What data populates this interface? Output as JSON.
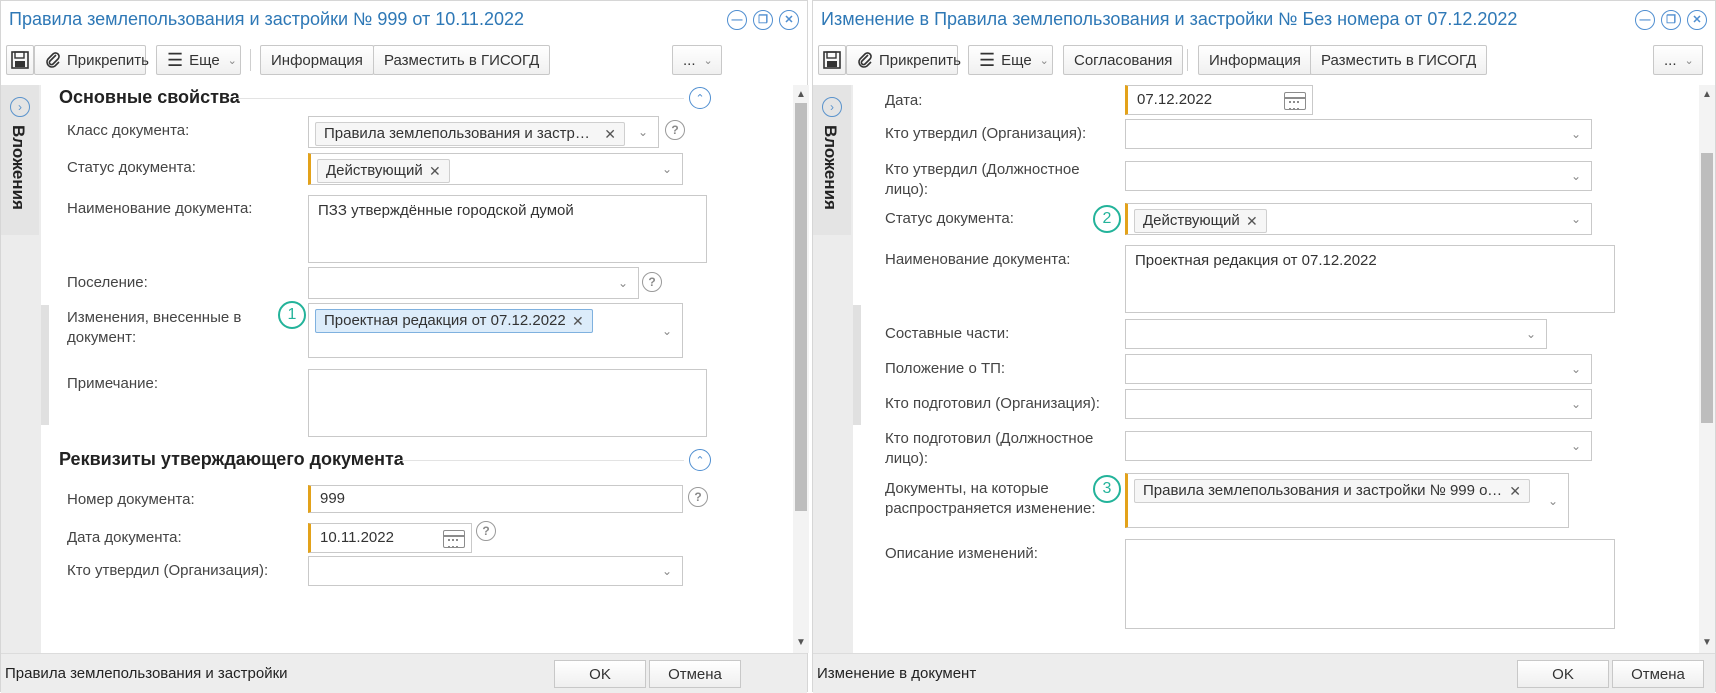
{
  "left": {
    "title": "Правила землепользования и застройки № 999 от 10.11.2022",
    "toolbar": {
      "attach": "Прикрепить",
      "more": "Еще",
      "info": "Информация",
      "place": "Разместить в ГИСОГД",
      "dots": "..."
    },
    "side_tab": "Вложения",
    "sections": {
      "main": "Основные свойства",
      "requisites": "Реквизиты утверждающего документа"
    },
    "fields": {
      "doc_class": {
        "label": "Класс документа:",
        "value": "Правила землепользования и застро…"
      },
      "status": {
        "label": "Статус документа:",
        "value": "Действующий"
      },
      "name": {
        "label": "Наименование документа:",
        "value": "ПЗЗ утверждённые городской думой"
      },
      "settlement": {
        "label": "Поселение:",
        "value": ""
      },
      "changes": {
        "label": "Изменения, внесенные в документ:",
        "value": "Проектная редакция от 07.12.2022",
        "marker": "1"
      },
      "note": {
        "label": "Примечание:",
        "value": ""
      },
      "doc_number": {
        "label": "Номер документа:",
        "value": "999"
      },
      "doc_date": {
        "label": "Дата документа:",
        "value": "10.11.2022"
      },
      "approved_org": {
        "label": "Кто утвердил (Организация):",
        "value": ""
      }
    },
    "footer": {
      "text": "Правила землепользования и застройки",
      "ok": "OK",
      "cancel": "Отмена"
    }
  },
  "right": {
    "title": "Изменение в Правила землепользования и застройки № Без номера от 07.12.2022",
    "toolbar": {
      "attach": "Прикрепить",
      "more": "Еще",
      "approvals": "Согласования",
      "info": "Информация",
      "place": "Разместить в ГИСОГД",
      "dots": "..."
    },
    "side_tab": "Вложения",
    "fields": {
      "date": {
        "label": "Дата:",
        "value": "07.12.2022"
      },
      "approved_org": {
        "label": "Кто утвердил (Организация):",
        "value": ""
      },
      "approved_person": {
        "label": "Кто утвердил (Должностное лицо):",
        "value": ""
      },
      "status": {
        "label": "Статус документа:",
        "value": "Действующий",
        "marker": "2"
      },
      "name": {
        "label": "Наименование документа:",
        "value": "Проектная редакция от 07.12.2022"
      },
      "parts": {
        "label": "Составные части:",
        "value": ""
      },
      "tp_position": {
        "label": "Положение о ТП:",
        "value": ""
      },
      "prepared_org": {
        "label": "Кто подготовил (Организация):",
        "value": ""
      },
      "prepared_person": {
        "label": "Кто подготовил (Должностное лицо):",
        "value": ""
      },
      "applies_to": {
        "label": "Документы, на которые распространяется изменение:",
        "value": "Правила землепользования и застройки № 999 от…",
        "marker": "3"
      },
      "description": {
        "label": "Описание изменений:",
        "value": ""
      }
    },
    "footer": {
      "text": "Изменение в документ",
      "ok": "OK",
      "cancel": "Отмена"
    }
  },
  "colors": {
    "accent": "#2e78b6",
    "required": "#e3a21a",
    "marker": "#23b39a",
    "chip_blue": "#dcecfa"
  }
}
